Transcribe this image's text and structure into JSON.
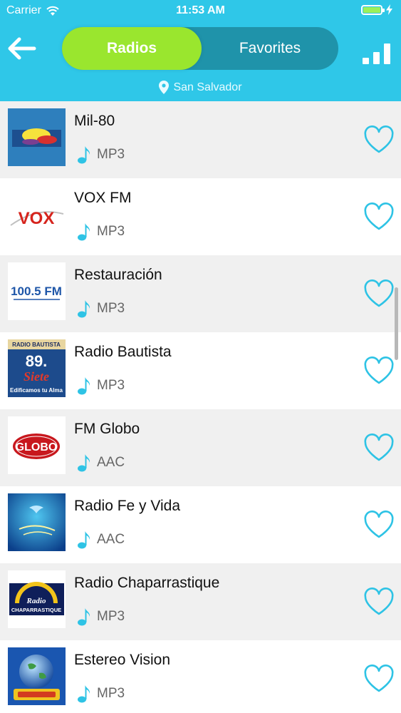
{
  "status": {
    "carrier": "Carrier",
    "time": "11:53 AM"
  },
  "header": {
    "tabs": [
      {
        "label": "Radios",
        "active": true
      },
      {
        "label": "Favorites",
        "active": false
      }
    ],
    "location": "San Salvador",
    "colors": {
      "header_bg": "#2fc7e8",
      "active_tab": "#9ae62e",
      "inactive_track": "#1f93aa",
      "accent_icon": "#2ec3e5"
    }
  },
  "stations": [
    {
      "name": "Mil-80",
      "format": "MP3"
    },
    {
      "name": "VOX FM",
      "format": "MP3"
    },
    {
      "name": "Restauración",
      "format": "MP3"
    },
    {
      "name": "Radio Bautista",
      "format": "MP3"
    },
    {
      "name": "FM Globo",
      "format": "AAC"
    },
    {
      "name": "Radio Fe y Vida",
      "format": "AAC"
    },
    {
      "name": "Radio Chaparrastique",
      "format": "MP3"
    },
    {
      "name": "Estereo Vision",
      "format": "MP3"
    }
  ],
  "logos": {
    "vox": "VOX",
    "restauracion": "100.5 FM",
    "bautista_top": "RADIO BAUTISTA",
    "bautista_freq": "89.",
    "bautista_sub": "Siete",
    "bautista_tag": "Edificamos tu Alma",
    "globo": "GLOBO",
    "chaparrastique_top": "Radio",
    "chaparrastique_bottom": "CHAPARRASTIQUE"
  }
}
